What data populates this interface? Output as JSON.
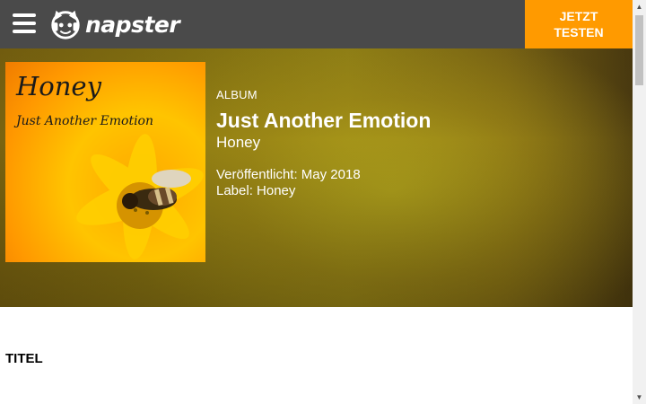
{
  "header": {
    "brand": "napster",
    "cta_label": "JETZT\nTESTEN",
    "icons": {
      "menu": "hamburger-menu-icon",
      "logo": "napster-cat-headphones-logo"
    },
    "colors": {
      "bar": "#4a4a4a",
      "cta": "#ff9a00"
    }
  },
  "album": {
    "type": "ALBUM",
    "title": "Just Another Emotion",
    "artist": "Honey",
    "release": "Veröffentlicht: May 2018",
    "label": "Label: Honey",
    "cover": {
      "title": "Honey",
      "subtitle": "Just Another Emotion"
    }
  },
  "tracks_section": {
    "title": "TITEL"
  },
  "scrollbar": {
    "up_icon": "scroll-up-arrow-icon",
    "down_icon": "scroll-down-arrow-icon"
  }
}
